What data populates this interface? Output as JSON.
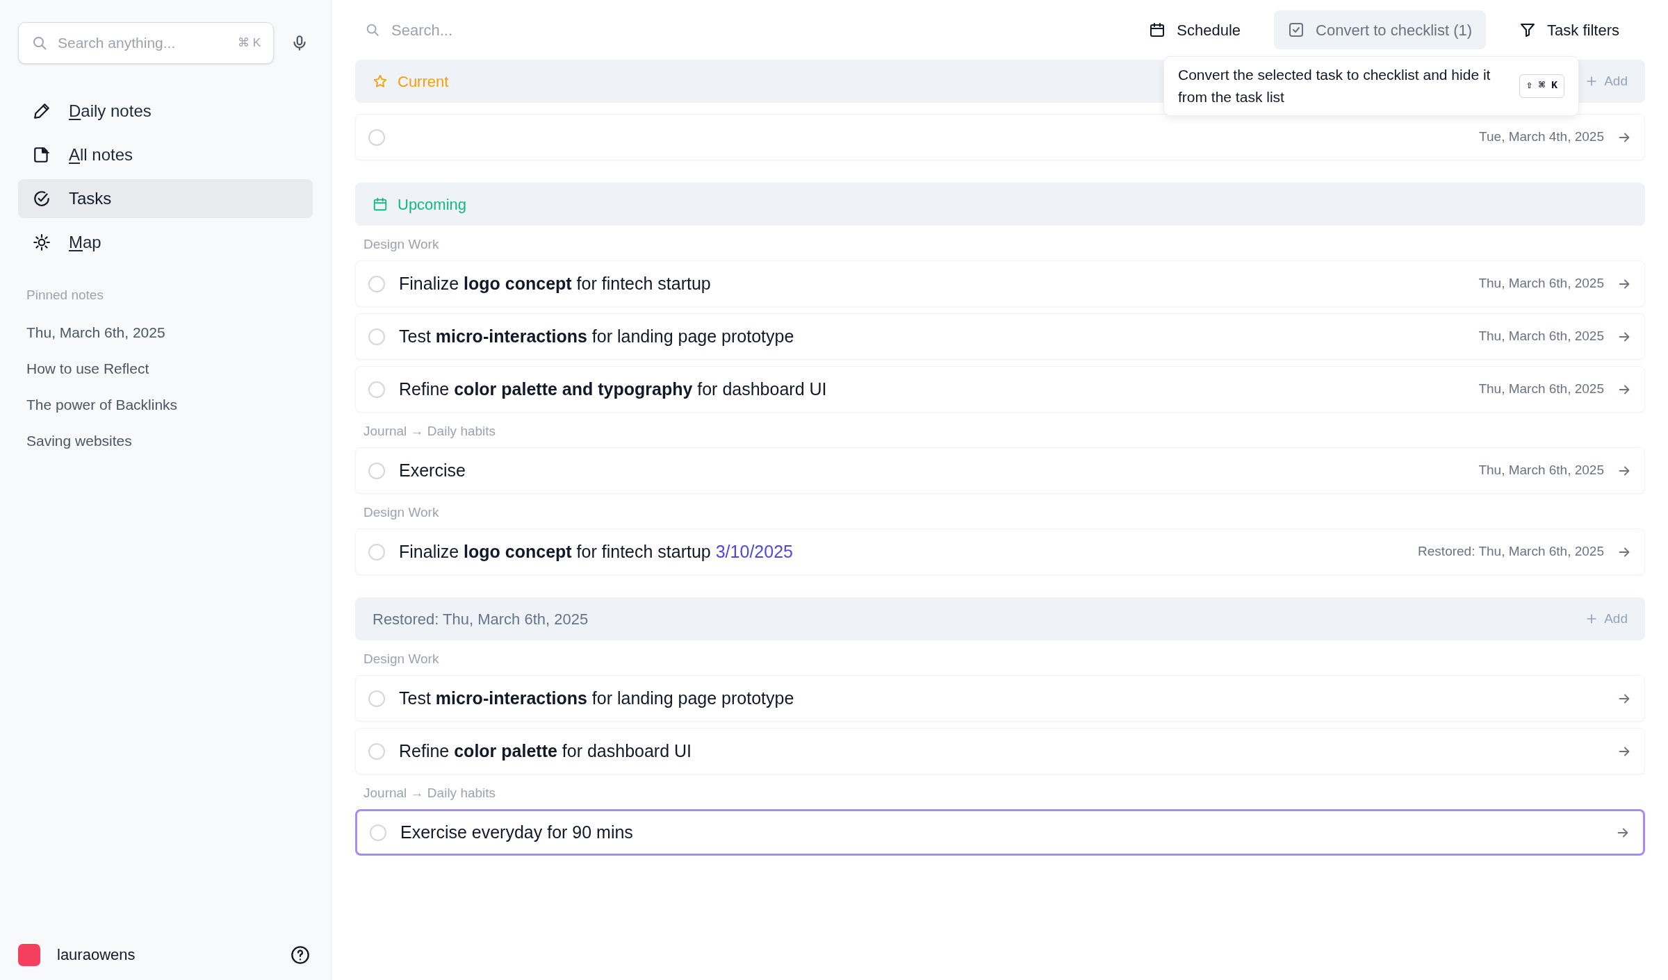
{
  "sidebar": {
    "search": {
      "placeholder": "Search anything...",
      "shortcut": "⌘ K"
    },
    "nav": [
      {
        "label": "Daily notes",
        "underlined_letter": true,
        "selected": false
      },
      {
        "label": "All notes",
        "underlined_letter": true,
        "selected": false
      },
      {
        "label": "Tasks",
        "underlined_letter": false,
        "selected": true
      },
      {
        "label": "Map",
        "underlined_letter": true,
        "selected": false
      }
    ],
    "pinned_title": "Pinned notes",
    "pinned": [
      "Thu, March 6th, 2025",
      "How to use Reflect",
      "The power of Backlinks",
      "Saving websites"
    ],
    "user": {
      "name": "lauraowens"
    }
  },
  "main": {
    "search": {
      "placeholder": "Search..."
    },
    "toolbar": [
      {
        "label": "Schedule",
        "highlighted": false
      },
      {
        "label": "Convert to checklist (1)",
        "highlighted": true
      },
      {
        "label": "Task filters",
        "highlighted": false
      }
    ],
    "tooltip": {
      "text": "Convert the selected task to checklist and hide it from the task list",
      "shortcut": "⇧ ⌘ K"
    },
    "sections": [
      {
        "kind": "current",
        "title": "Current",
        "color": "#f59e0b",
        "add_label": "Add",
        "groups": [
          {
            "rows": [
              {
                "checked": false,
                "selected": false,
                "date": "Tue, March 4th, 2025"
              }
            ]
          }
        ]
      },
      {
        "kind": "upcoming",
        "title": "Upcoming",
        "color": "#10b981",
        "groups": [
          {
            "label": "Design Work",
            "rows": [
              {
                "text": "Finalize **logo concept** for fintech startup",
                "checked": false,
                "selected": false,
                "date": "Thu, March 6th, 2025"
              },
              {
                "text": "Test **micro-interactions** for landing page prototype",
                "checked": false,
                "selected": false,
                "date": "Thu, March 6th, 2025"
              },
              {
                "text": "Refine **color palette and typography** for dashboard UI",
                "checked": false,
                "selected": false,
                "date": "Thu, March 6th, 2025"
              }
            ]
          },
          {
            "label": "Journal → Daily habits",
            "rows": [
              {
                "text": "Exercise",
                "checked": false,
                "selected": false,
                "date": "Thu, March 6th, 2025"
              }
            ]
          },
          {
            "label": "Design Work",
            "rows": [
              {
                "text": "Finalize **logo concept** for fintech startup",
                "date_link": "3/10/2025",
                "checked": false,
                "selected": false,
                "date": "Restored: Thu, March 6th, 2025"
              }
            ]
          }
        ]
      },
      {
        "kind": "date",
        "title": "Restored: Thu, March 6th, 2025",
        "color": "#64748b",
        "add_label": "Add",
        "groups": [
          {
            "label": "Design Work",
            "rows": [
              {
                "text": "Test **micro-interactions** for landing page prototype",
                "checked": false,
                "selected": false
              },
              {
                "text": "Refine **color palette** for dashboard UI",
                "checked": false,
                "selected": false
              }
            ]
          },
          {
            "label": "Journal → Daily habits",
            "rows": [
              {
                "text": "Exercise everyday for 90 mins",
                "checked": false,
                "selected": true
              }
            ]
          }
        ]
      }
    ]
  }
}
